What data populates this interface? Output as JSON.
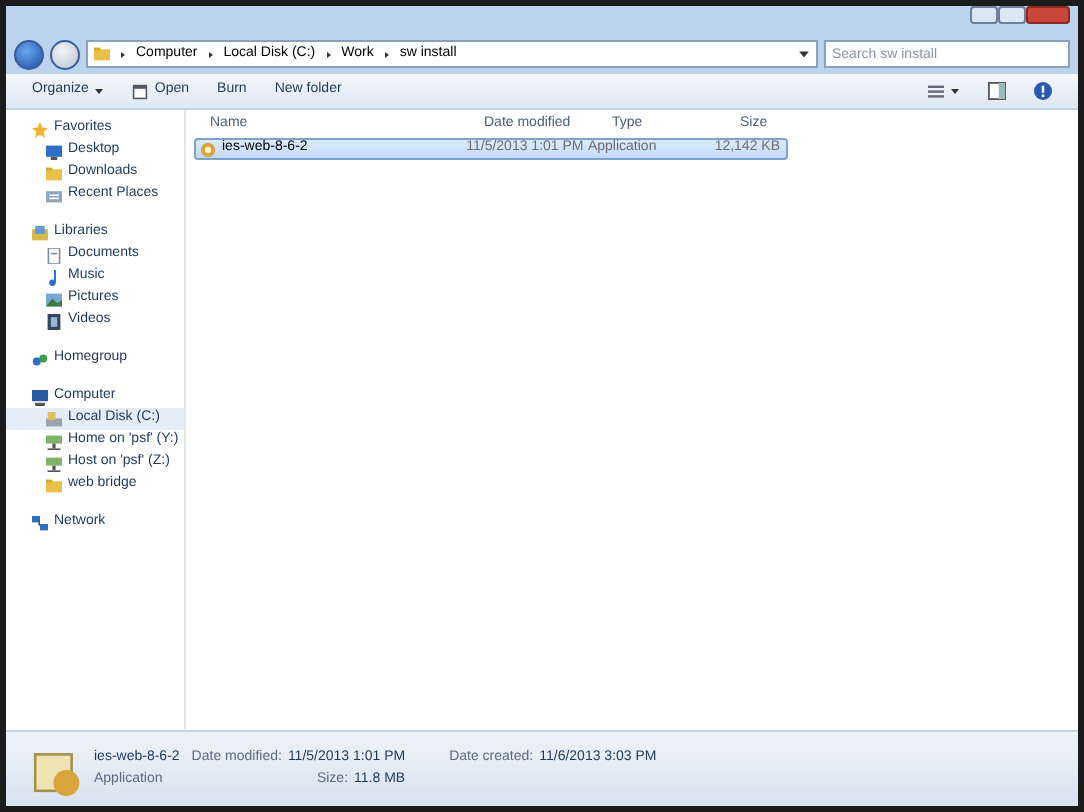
{
  "address": {
    "crumbs": [
      "Computer",
      "Local Disk (C:)",
      "Work",
      "sw install"
    ]
  },
  "search": {
    "placeholder": "Search sw install"
  },
  "toolbar": {
    "buttons": [
      {
        "label": "Organize",
        "kind": "menu"
      },
      {
        "label": "Open",
        "kind": "icon"
      },
      {
        "label": "Burn",
        "kind": "plain"
      },
      {
        "label": "New folder",
        "kind": "plain"
      }
    ]
  },
  "sidebar": {
    "groups": [
      {
        "label": "Favorites",
        "kind": "star",
        "children": [
          {
            "label": "Desktop",
            "kind": "desktop",
            "selected": false
          },
          {
            "label": "Downloads",
            "kind": "folder",
            "selected": false
          },
          {
            "label": "Recent Places",
            "kind": "recent",
            "selected": false
          }
        ]
      },
      {
        "label": "Libraries",
        "kind": "library",
        "children": [
          {
            "label": "Documents",
            "kind": "doc",
            "selected": false
          },
          {
            "label": "Music",
            "kind": "music",
            "selected": false
          },
          {
            "label": "Pictures",
            "kind": "pictures",
            "selected": false
          },
          {
            "label": "Videos",
            "kind": "video",
            "selected": false
          }
        ]
      },
      {
        "label": "Homegroup",
        "kind": "homegroup"
      },
      {
        "label": "Computer",
        "kind": "computer",
        "children": [
          {
            "label": "Local Disk (C:)",
            "kind": "disk",
            "selected": true
          },
          {
            "label": "Home on 'psf' (Y:)",
            "kind": "netdrive",
            "selected": false
          },
          {
            "label": "Host on 'psf' (Z:)",
            "kind": "netdrive",
            "selected": false
          },
          {
            "label": "web bridge",
            "kind": "folder",
            "selected": false
          }
        ]
      },
      {
        "label": "Network",
        "kind": "network"
      }
    ]
  },
  "table": {
    "columns": [
      "Name",
      "Date modified",
      "Type",
      "Size"
    ],
    "rows": [
      {
        "cells": [
          "ies-web-8-6-2",
          "11/5/2013 1:01 PM",
          "Application",
          "12,142 KB"
        ],
        "selected": true
      }
    ]
  },
  "details": {
    "name": "ies-web-8-6-2",
    "type": "Application",
    "fields": [
      {
        "label": "Date modified:",
        "value": "11/5/2013 1:01 PM"
      },
      {
        "label": "Date created:",
        "value": "11/6/2013 3:03 PM"
      },
      {
        "label": "Size:",
        "value": "11.8 MB"
      }
    ]
  }
}
